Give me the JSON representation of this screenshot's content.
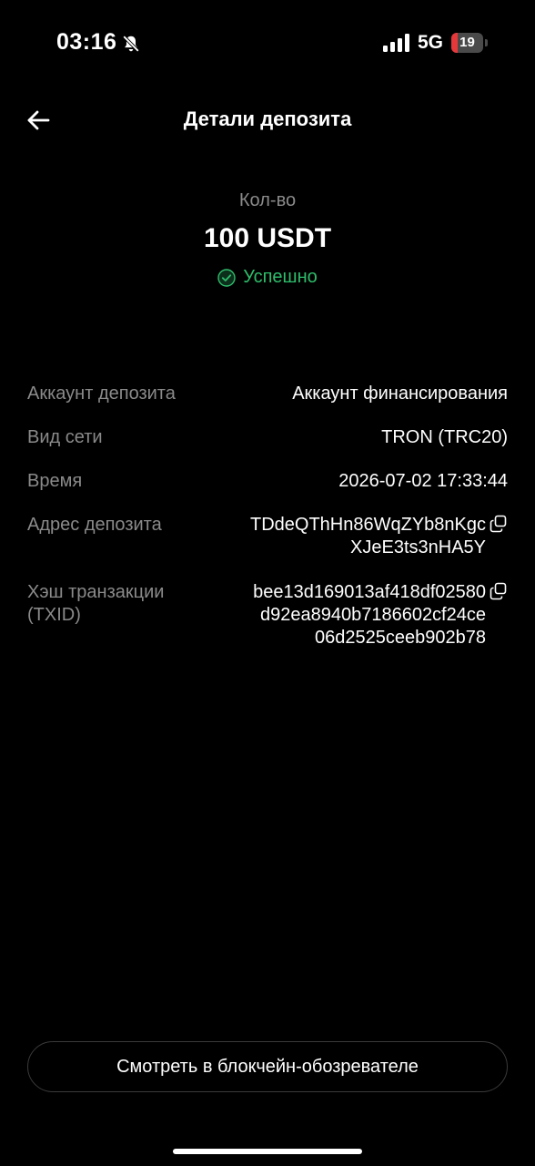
{
  "status_bar": {
    "time": "03:16",
    "network": "5G",
    "battery_level": "19",
    "battery_fraction": 0.19,
    "icons": [
      "bell-slash-icon",
      "signal-icon",
      "battery-icon"
    ]
  },
  "header": {
    "title": "Детали депозита",
    "back_icon": "arrow-left-icon"
  },
  "amount": {
    "label": "Кол-во",
    "value": "100 USDT",
    "status": "Успешно",
    "status_icon": "check-circle-icon",
    "status_color": "#2ebd6b"
  },
  "details": {
    "account": {
      "label": "Аккаунт депозита",
      "value": "Аккаунт финансирования"
    },
    "network": {
      "label": "Вид сети",
      "value": "TRON (TRC20)"
    },
    "time": {
      "label": "Время",
      "value": "2026-07-02 17:33:44"
    },
    "address": {
      "label": "Адрес депозита",
      "line1": "TDdeQThHn86WqZYb8nKgc",
      "line2": "XJeE3ts3nHA5Y",
      "icon": "copy-icon"
    },
    "txid": {
      "label": "Хэш транзакции (TXID)",
      "line1": "bee13d169013af418df02580",
      "line2": "d92ea8940b7186602cf24ce",
      "line3": "06d2525ceeb902b78",
      "icon": "copy-icon"
    }
  },
  "footer": {
    "explorer_button": "Смотреть в блокчейн-обозревателе"
  },
  "colors": {
    "background": "#000000",
    "text_primary": "#ffffff",
    "text_secondary": "#8a8a8a",
    "success": "#2ebd6b",
    "battery_low": "#e5383b"
  }
}
